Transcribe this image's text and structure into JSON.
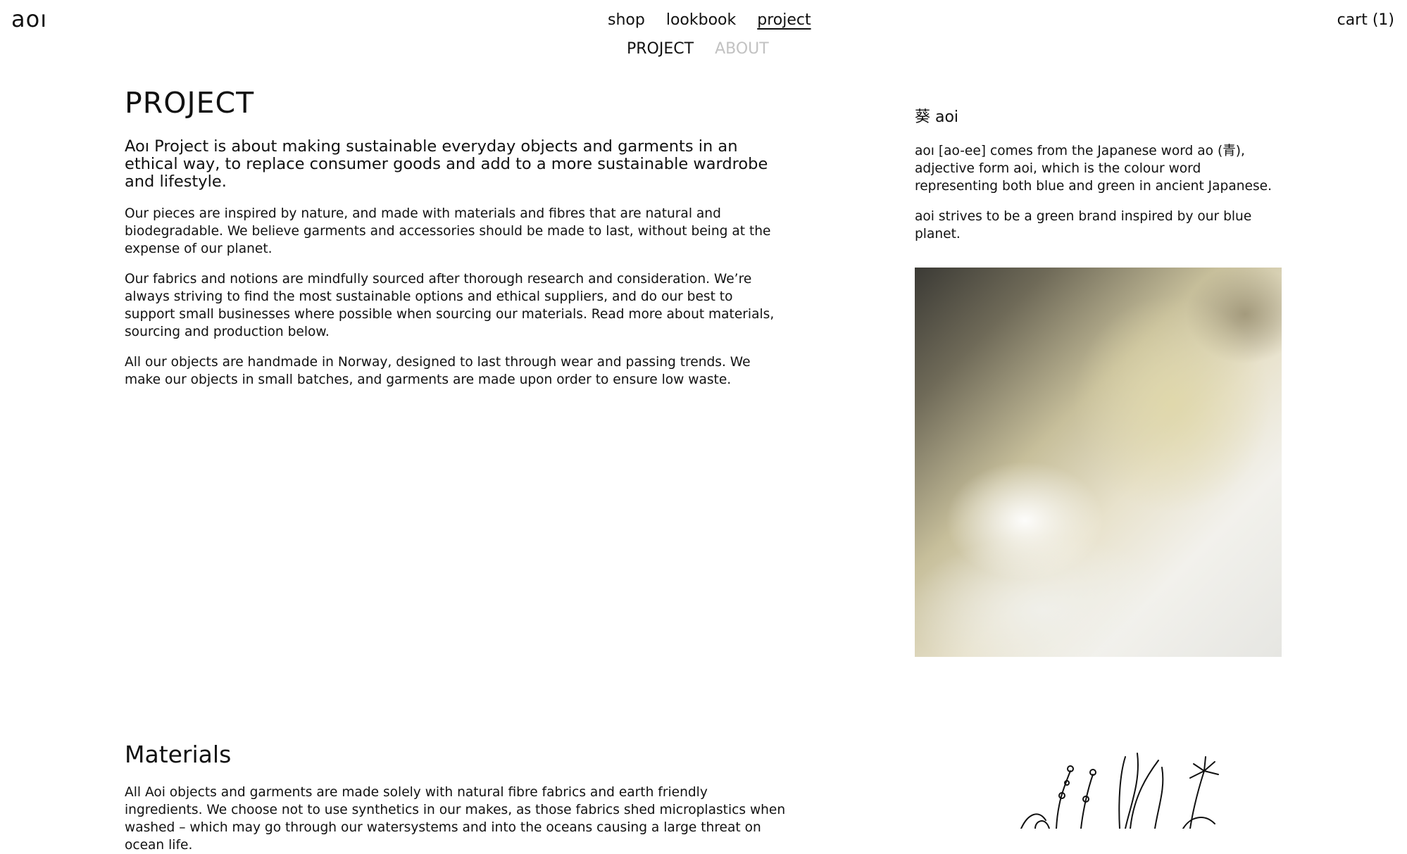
{
  "header": {
    "logo": "aoı",
    "nav": [
      {
        "label": "shop"
      },
      {
        "label": "lookbook"
      },
      {
        "label": "project"
      }
    ],
    "cart": "cart (1)"
  },
  "subnav": {
    "project": "PROJECT",
    "about": "ABOUT"
  },
  "main": {
    "title": "PROJECT",
    "lead": "Aoı Project is about making sustainable everyday objects and garments in an ethical way, to replace consumer goods and add to a more sustainable wardrobe and lifestyle.",
    "paragraphs": [
      "Our pieces are inspired by nature, and made with materials and fibres that are natural and biodegradable. We believe garments and accessories should be made to last, without being at the expense of our planet.",
      "Our fabrics and notions are mindfully sourced after thorough research and consideration. We’re always striving to find the most sustainable options and ethical suppliers, and do our best to support small businesses where possible when sourcing our materials. Read more about materials, sourcing and production below.",
      "All our objects are handmade in Norway, designed to last through wear and passing trends. We make our objects in small batches, and garments are made upon order to ensure low waste."
    ]
  },
  "sidebar": {
    "heading": "葵 aoi",
    "paragraphs": [
      "aoı [ao-ee] comes from the Japanese word ao (青), adjective form aoi, which is the colour word representing both blue and green in ancient Japanese.",
      "aoi strives to be a green brand inspired by our blue planet."
    ],
    "image_icon": "waterfall-photo"
  },
  "materials": {
    "heading": "Materials",
    "text": "All Aoi objects and garments are made solely with natural fibre fabrics and earth friendly ingredients. We choose not to use synthetics in our makes, as those fabrics shed microplastics when washed – which may go through our watersystems and into the oceans causing a large threat on ocean life."
  },
  "colors": {
    "text": "#111111",
    "muted": "#c2c2c2",
    "background": "#ffffff"
  }
}
